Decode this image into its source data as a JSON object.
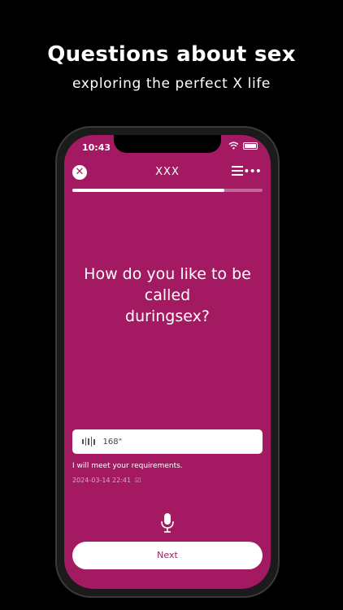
{
  "promo": {
    "headline": "Questions about sex",
    "subline": "exploring the perfect X life"
  },
  "status_bar": {
    "time": "10:43"
  },
  "nav": {
    "title": "XXX"
  },
  "progress": {
    "fraction": 0.8
  },
  "question": {
    "line1": "How do you like to be",
    "line2": "called",
    "line3": "duringsex?"
  },
  "answer": {
    "voice_duration": "168\"",
    "reply_text": "I will meet your requirements.",
    "timestamp": "2024-03-14 22:41"
  },
  "actions": {
    "next_label": "Next"
  },
  "colors": {
    "accent": "#a41a62",
    "background": "#000000"
  },
  "icons": [
    "close-icon",
    "menu-icon",
    "more-icon",
    "wave-icon",
    "microphone-icon",
    "wifi-icon",
    "battery-icon"
  ]
}
